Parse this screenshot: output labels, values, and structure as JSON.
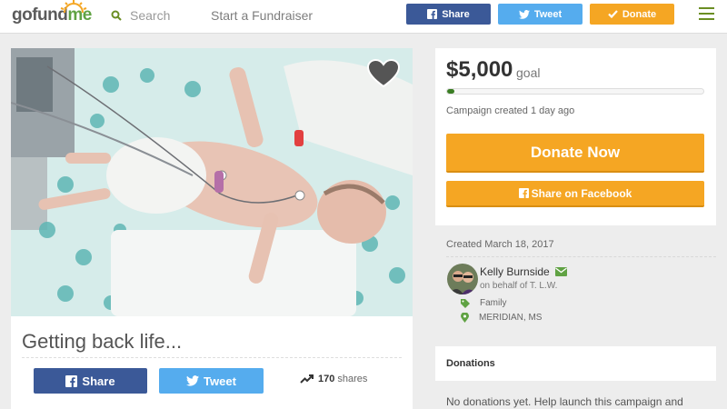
{
  "header": {
    "logo_prefix": "gofund",
    "logo_suffix": "me",
    "search_placeholder": "Search",
    "start_fundraiser": "Start a Fundraiser",
    "share_label": "Share",
    "tweet_label": "Tweet",
    "donate_label": "Donate"
  },
  "campaign": {
    "title": "Getting back life...",
    "share_label": "Share",
    "tweet_label": "Tweet",
    "shares_count": "170",
    "shares_label": "shares"
  },
  "goal": {
    "amount": "$5,000",
    "goal_word": "goal",
    "progress_fraction": 0.03,
    "created_relative": "Campaign created 1 day ago",
    "donate_now": "Donate Now",
    "share_facebook": "Share on Facebook"
  },
  "organizer": {
    "created_date": "Created March 18, 2017",
    "name": "Kelly Burnside",
    "on_behalf": "on behalf of T. L.W.",
    "category": "Family",
    "location": "MERIDIAN, MS"
  },
  "donations": {
    "title": "Donations",
    "empty_text": "No donations yet. Help launch this campaign and"
  },
  "colors": {
    "facebook": "#3b5998",
    "twitter": "#55acee",
    "donate": "#f5a623",
    "brand_green": "#60a243"
  }
}
